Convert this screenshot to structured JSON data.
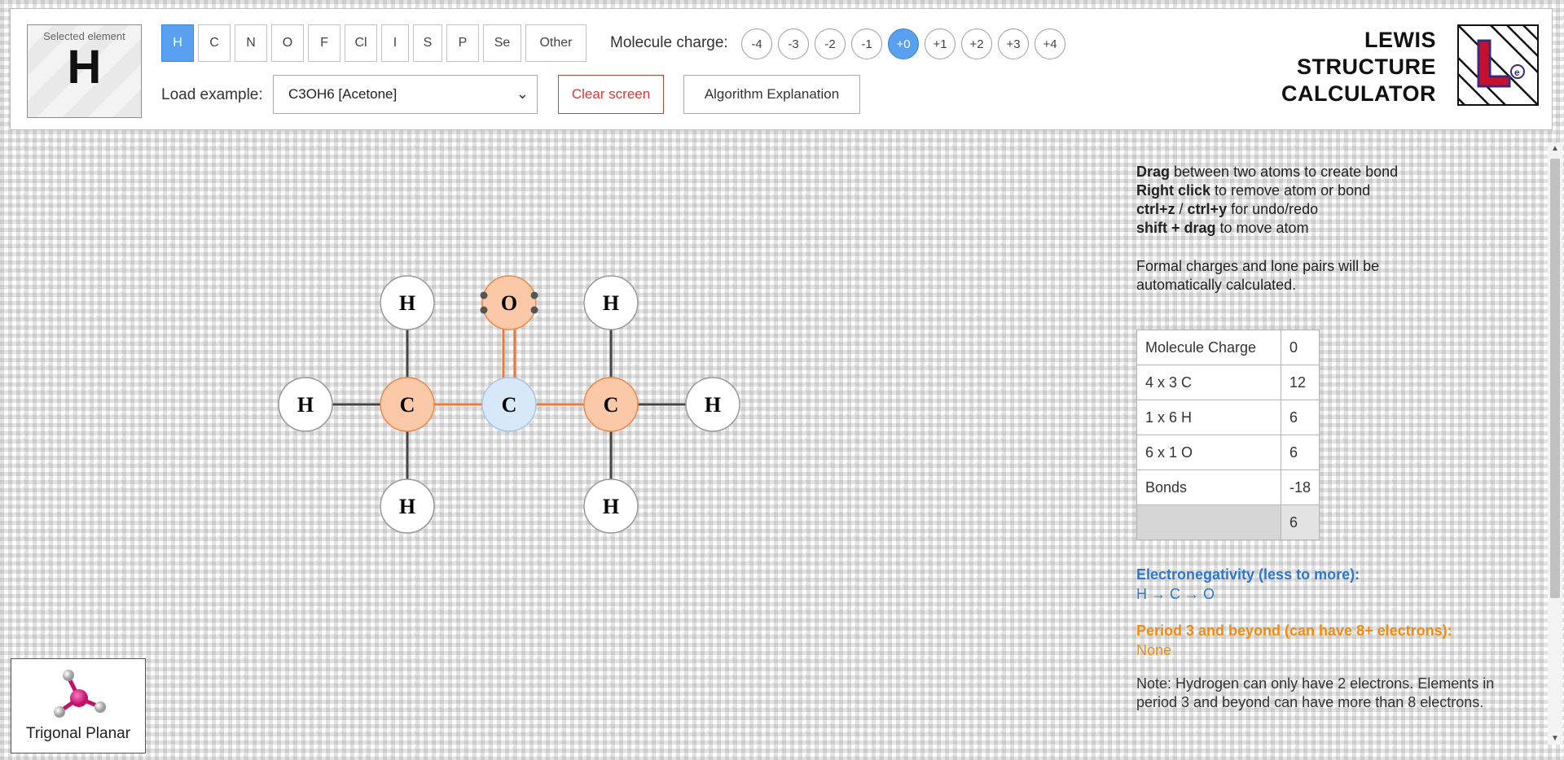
{
  "selected_element": {
    "label": "Selected element",
    "symbol": "H"
  },
  "elements": [
    "H",
    "C",
    "N",
    "O",
    "F",
    "Cl",
    "I",
    "S",
    "P",
    "Se",
    "Other"
  ],
  "active_element": "H",
  "molecule_charge": {
    "label": "Molecule charge:",
    "options": [
      "-4",
      "-3",
      "-2",
      "-1",
      "+0",
      "+1",
      "+2",
      "+3",
      "+4"
    ],
    "active": "+0"
  },
  "load_example": {
    "label": "Load example:",
    "value": "C3OH6 [Acetone]"
  },
  "buttons": {
    "clear": "Clear screen",
    "algorithm": "Algorithm Explanation"
  },
  "app_title": [
    "LEWIS",
    "STRUCTURE",
    "CALCULATOR"
  ],
  "molecule": {
    "atoms": [
      {
        "symbol": "H",
        "type": "hydrogen"
      },
      {
        "symbol": "C",
        "type": "orange"
      },
      {
        "symbol": "C",
        "type": "blue"
      },
      {
        "symbol": "C",
        "type": "orange"
      },
      {
        "symbol": "H",
        "type": "hydrogen"
      },
      {
        "symbol": "H",
        "type": "hydrogen"
      },
      {
        "symbol": "O",
        "type": "orange",
        "lone_pairs": 2
      },
      {
        "symbol": "H",
        "type": "hydrogen"
      },
      {
        "symbol": "H",
        "type": "hydrogen"
      },
      {
        "symbol": "H",
        "type": "hydrogen"
      }
    ],
    "colors": {
      "orange_fill": "#fbc9a8",
      "orange_stroke": "#e8894f",
      "blue_fill": "#d7e8f8",
      "blue_stroke": "#a9c6e4",
      "bond_dark": "#444444",
      "bond_orange": "#ea7a3c"
    }
  },
  "instructions": [
    {
      "bold": "Drag",
      "text": " between two atoms to create bond"
    },
    {
      "bold": "Right click",
      "text": " to remove atom or bond"
    },
    {
      "bold": "ctrl+z",
      "sep": " / ",
      "bold2": "ctrl+y",
      "text": " for undo/redo"
    },
    {
      "bold": "shift + drag",
      "text": " to move atom"
    }
  ],
  "auto_note": "Formal charges and lone pairs will be automatically calculated.",
  "valence_table": [
    {
      "label": "Molecule Charge",
      "value": "0"
    },
    {
      "label": "4 x 3 C",
      "value": "12"
    },
    {
      "label": "1 x 6 H",
      "value": "6"
    },
    {
      "label": "6 x 1 O",
      "value": "6"
    },
    {
      "label": "Bonds",
      "value": "-18"
    },
    {
      "label": "",
      "value": "6"
    }
  ],
  "electronegativity": {
    "title": "Electronegativity (less to more):",
    "value": "H → C → O"
  },
  "period3": {
    "title": "Period 3 and beyond (can have 8+ electrons):",
    "value": "None"
  },
  "hydrogen_note": "Note: Hydrogen can only have 2 electrons. Elements in period 3 and beyond can have more than 8 electrons.",
  "geometry": {
    "label": "Trigonal Planar"
  }
}
